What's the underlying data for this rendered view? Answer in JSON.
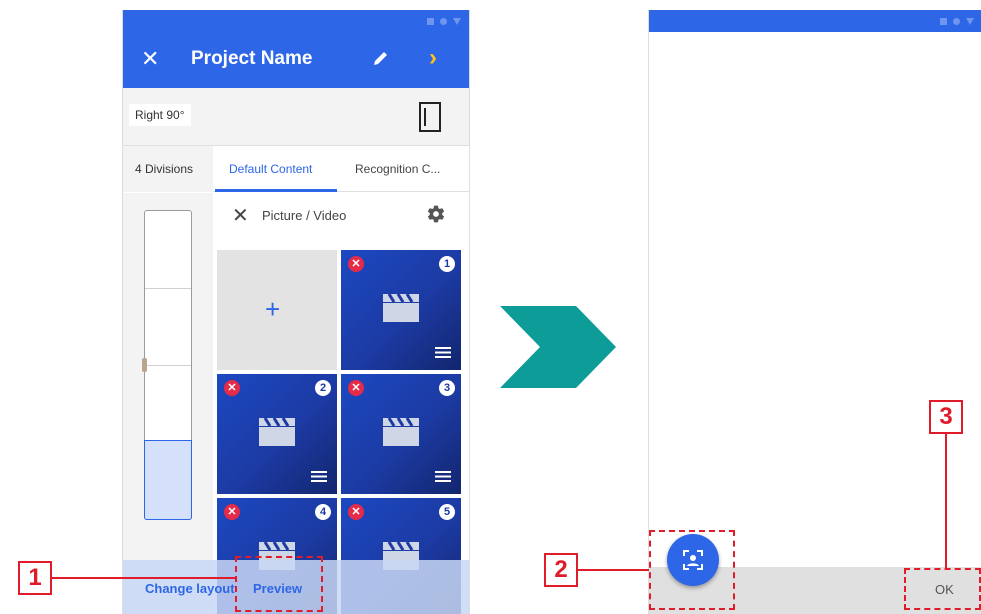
{
  "left_screen": {
    "app_bar": {
      "title": "Project Name",
      "close_icon": "close-icon",
      "edit_icon": "pencil-icon",
      "next_icon": "chevron-right-icon"
    },
    "rotation": {
      "label": "Right 90°",
      "orientation_icon": "portrait-orientation-icon"
    },
    "tabs": [
      {
        "label": "4 Divisions"
      },
      {
        "label": "Default Content",
        "active": true
      },
      {
        "label": "Recognition C..."
      }
    ],
    "content_header": {
      "label": "Picture / Video",
      "remove_icon": "close-icon",
      "settings_icon": "gear-icon"
    },
    "slider": {
      "divisions": 4,
      "selected": 4
    },
    "grid": [
      {
        "type": "add",
        "symbol": "+"
      },
      {
        "type": "media",
        "number": "1"
      },
      {
        "type": "media",
        "number": "2"
      },
      {
        "type": "media",
        "number": "3"
      },
      {
        "type": "media",
        "number": "4"
      },
      {
        "type": "media",
        "number": "5"
      }
    ],
    "bottom_bar": {
      "change_layout": "Change layout",
      "preview": "Preview"
    }
  },
  "right_screen": {
    "ok_label": "OK",
    "fab_icon": "face-scan-icon"
  },
  "callouts": [
    {
      "number": "1"
    },
    {
      "number": "2"
    },
    {
      "number": "3"
    }
  ],
  "colors": {
    "primary": "#2d66e6",
    "accent": "#ffc11a",
    "callout": "#e01c2a",
    "arrow": "#0e9c98",
    "delete": "#e52b48"
  }
}
